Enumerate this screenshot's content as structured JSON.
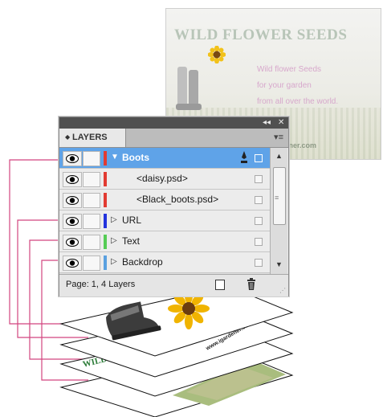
{
  "poster": {
    "title": "WILD FLOWER SEEDS",
    "copy": [
      "Wild flower Seeds",
      "for your garden",
      "from all over the world."
    ],
    "url": "dener.com"
  },
  "panel": {
    "collapse_icon": "◂◂",
    "close_icon": "✕",
    "tab_label": "LAYERS",
    "menu_icon": "▾≡",
    "layers": [
      {
        "name": "Boots",
        "color": "#e23b32",
        "selected": true,
        "expanded": true,
        "sub": false
      },
      {
        "name": "<daisy.psd>",
        "color": "#e23b32",
        "selected": false,
        "sub": true
      },
      {
        "name": "<Black_boots.psd>",
        "color": "#e23b32",
        "selected": false,
        "sub": true
      },
      {
        "name": "URL",
        "color": "#2233dd",
        "selected": false,
        "sub": false
      },
      {
        "name": "Text",
        "color": "#55cc55",
        "selected": false,
        "sub": false
      },
      {
        "name": "Backdrop",
        "color": "#5aa0e0",
        "selected": false,
        "sub": false
      }
    ],
    "status": "Page: 1, 4 Layers",
    "icons": {
      "new_layer": "new-layer-icon",
      "delete": "trash-icon",
      "pen": "pen-icon",
      "eye": "eye-icon"
    }
  },
  "sheets": {
    "url_text": "www.igardener.com",
    "wild_text": "WILD",
    "connector_color": "#d2457f"
  }
}
